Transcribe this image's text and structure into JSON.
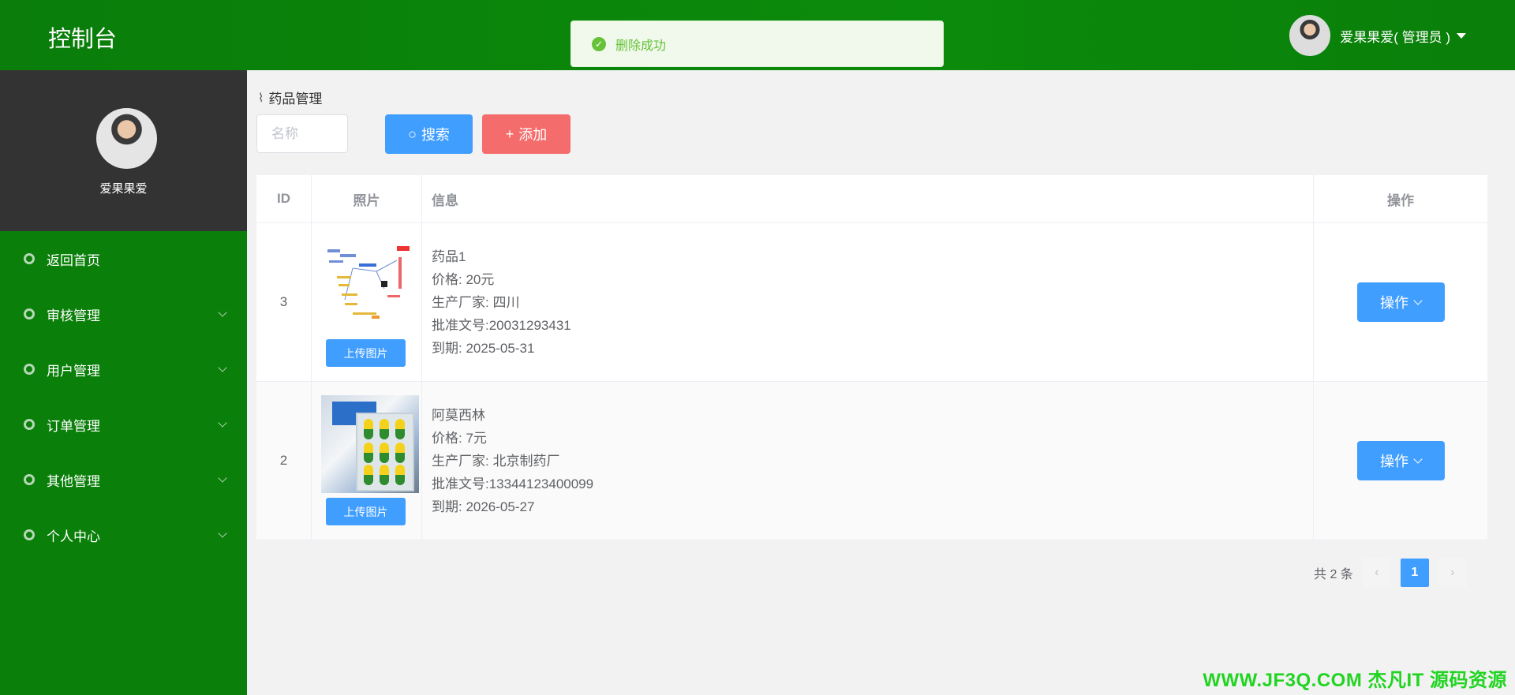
{
  "header": {
    "title": "控制台",
    "user_name": "爱果果爱( 管理员 )"
  },
  "toast": {
    "message": "删除成功"
  },
  "sidebar": {
    "profile_name": "爱果果爱",
    "items": [
      {
        "label": "返回首页"
      },
      {
        "label": "审核管理"
      },
      {
        "label": "用户管理"
      },
      {
        "label": "订单管理"
      },
      {
        "label": "其他管理"
      },
      {
        "label": "个人中心"
      }
    ]
  },
  "breadcrumb": "药品管理",
  "search": {
    "placeholder": "名称",
    "search_label": "搜索",
    "add_label": "添加"
  },
  "table": {
    "headers": {
      "id": "ID",
      "photo": "照片",
      "info": "信息",
      "op": "操作"
    },
    "upload_label": "上传图片",
    "op_label": "操作",
    "rows": [
      {
        "id": "3",
        "lines": [
          "药品1",
          "价格:  20元",
          "生产厂家:  四川",
          "批准文号:20031293431",
          "到期:  2025-05-31"
        ]
      },
      {
        "id": "2",
        "lines": [
          "阿莫西林",
          "价格:  7元",
          "生产厂家:  北京制药厂",
          "批准文号:13344123400099",
          "到期:  2026-05-27"
        ]
      }
    ]
  },
  "pagination": {
    "total_text": "共 2 条",
    "current_page": "1",
    "prev": "‹",
    "next": "›"
  },
  "watermark": "WWW.JF3Q.COM 杰凡IT  源码资源",
  "colors": {
    "header_green": "#0a7f0a",
    "primary": "#409eff",
    "danger": "#f56c6c",
    "success": "#67c23a"
  }
}
